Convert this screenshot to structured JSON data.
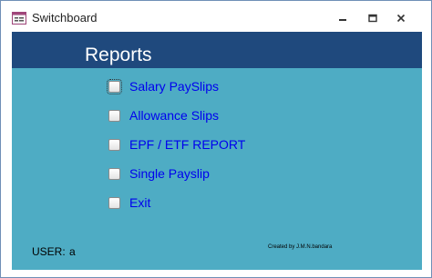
{
  "window": {
    "title": "Switchboard",
    "accent_border": "#6f8fb7"
  },
  "colors": {
    "header_band": "#1f497d",
    "background": "#4eacc4",
    "link_text": "#0000ee"
  },
  "header": {
    "title": "Reports"
  },
  "menu": {
    "items": [
      {
        "label": "Salary PaySlips"
      },
      {
        "label": "Allowance Slips"
      },
      {
        "label": "EPF / ETF REPORT"
      },
      {
        "label": "Single Payslip"
      },
      {
        "label": "Exit"
      }
    ]
  },
  "footer": {
    "user_label": "USER:",
    "user_value": "a",
    "credit": "Created by J.M.N.bandara"
  },
  "icons": {
    "app": "form-icon",
    "minimize": "minimize-icon",
    "maximize": "restore-icon",
    "close": "close-icon"
  }
}
